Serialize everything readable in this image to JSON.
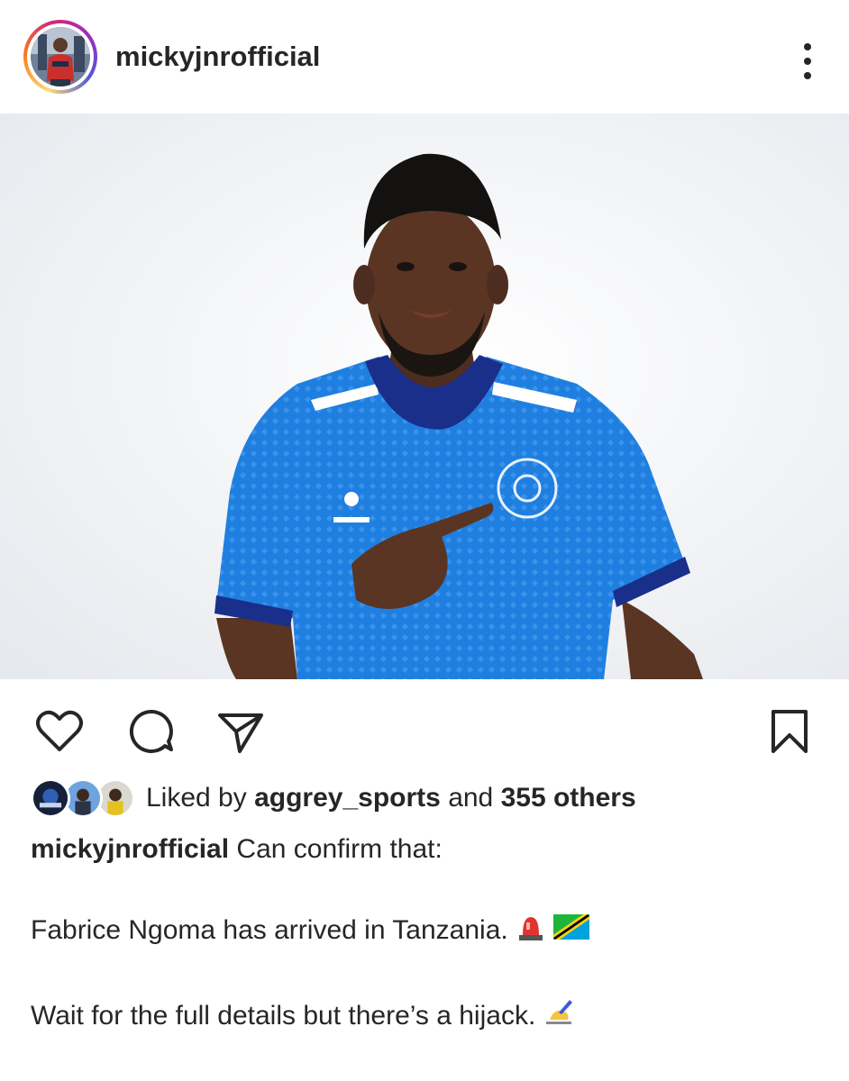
{
  "post": {
    "username": "mickyjnrofficial",
    "more_icon": "more-vertical-icon"
  },
  "actions": {
    "like_icon": "heart-icon",
    "comment_icon": "comment-icon",
    "share_icon": "send-icon",
    "save_icon": "bookmark-icon"
  },
  "likes": {
    "prefix": "Liked by",
    "user": "aggrey_sports",
    "joiner": "and",
    "others": "355 others"
  },
  "caption": {
    "username": "mickyjnrofficial",
    "line1": "Can confirm that:",
    "line2": "Fabrice Ngoma has arrived in Tanzania.",
    "line3": "Wait for the full details but there’s a hijack."
  },
  "colors": {
    "text": "#262626",
    "jersey": "#1f7fe0",
    "collar": "#1a2f8a",
    "background": "#ffffff"
  }
}
